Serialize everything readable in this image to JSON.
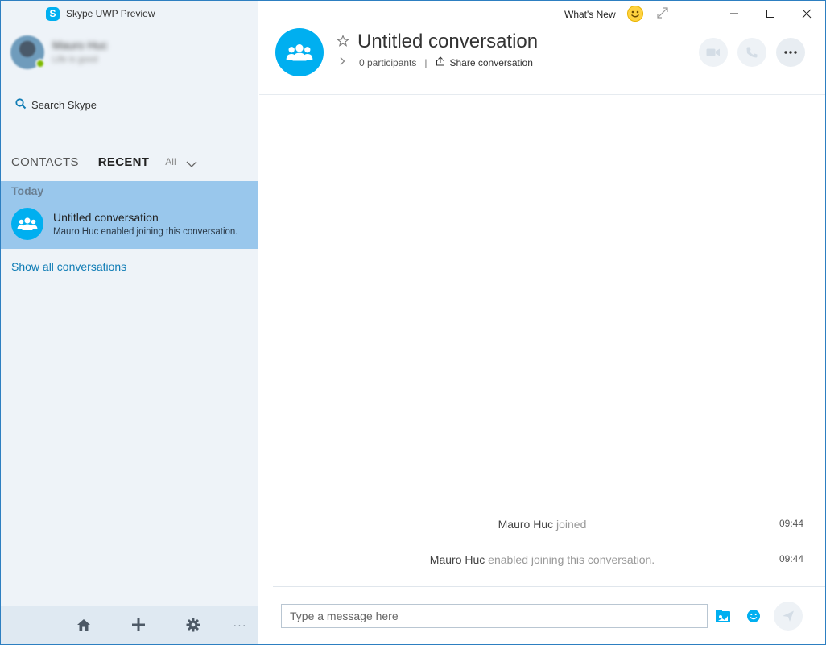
{
  "app": {
    "title": "Skype UWP Preview",
    "whats_new": "What's New",
    "accent": "#00aff0"
  },
  "profile": {
    "name": "Mauro Huc",
    "mood": "Life is good"
  },
  "search": {
    "label": "Search Skype"
  },
  "tabs": [
    {
      "label": "CONTACTS",
      "active": false
    },
    {
      "label": "RECENT",
      "active": true
    }
  ],
  "filter": {
    "label": "All"
  },
  "recent": {
    "section_label": "Today",
    "items": [
      {
        "title": "Untitled conversation",
        "subtitle": "Mauro Huc enabled joining this conversation."
      }
    ],
    "show_all": "Show all conversations"
  },
  "bottom_bar": {
    "icons": [
      "home-icon",
      "add-icon",
      "gear-icon",
      "more-icon"
    ],
    "more_glyph": "···"
  },
  "conversation": {
    "title": "Untitled conversation",
    "participants": "0 participants",
    "separator": "|",
    "share": "Share conversation"
  },
  "messages": [
    {
      "name": "Mauro Huc",
      "action": "joined",
      "time": "09:44"
    },
    {
      "name": "Mauro Huc",
      "action": "enabled joining this conversation.",
      "time": "09:44"
    }
  ],
  "composer": {
    "placeholder": "Type a message here"
  }
}
